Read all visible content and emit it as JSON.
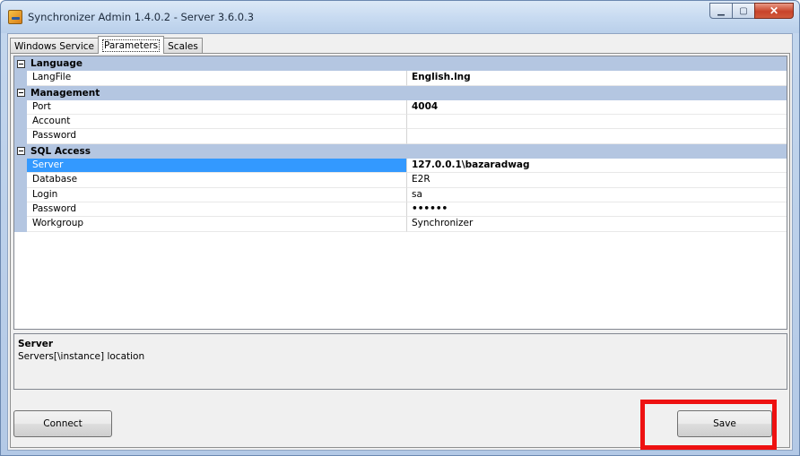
{
  "window": {
    "title": "Synchronizer Admin 1.4.0.2 - Server 3.6.0.3",
    "minimize_glyph": "▁",
    "maximize_glyph": "▢",
    "close_glyph": "✕"
  },
  "tabs": [
    {
      "label": "Windows Service",
      "active": false
    },
    {
      "label": "Parameters",
      "active": true
    },
    {
      "label": "Scales",
      "active": false
    }
  ],
  "property_grid": {
    "categories": [
      {
        "name": "Language",
        "properties": [
          {
            "name": "LangFile",
            "value": "English.lng",
            "bold": true
          }
        ]
      },
      {
        "name": "Management",
        "properties": [
          {
            "name": "Port",
            "value": "4004",
            "bold": true
          },
          {
            "name": "Account",
            "value": "",
            "bold": false
          },
          {
            "name": "Password",
            "value": "",
            "bold": false
          }
        ]
      },
      {
        "name": "SQL Access",
        "properties": [
          {
            "name": "Server",
            "value": "127.0.0.1\\bazaradwag",
            "bold": true,
            "selected": true
          },
          {
            "name": "Database",
            "value": "E2R",
            "bold": false
          },
          {
            "name": "Login",
            "value": "sa",
            "bold": false
          },
          {
            "name": "Password",
            "value": "••••••",
            "bold": true
          },
          {
            "name": "Workgroup",
            "value": "Synchronizer",
            "bold": false
          }
        ]
      }
    ]
  },
  "description": {
    "title": "Server",
    "text": "Servers[\\instance] location"
  },
  "buttons": {
    "connect_label": "Connect",
    "save_label": "Save"
  },
  "colors": {
    "category_bg": "#b4c6e1",
    "highlight": "#ee1111"
  }
}
